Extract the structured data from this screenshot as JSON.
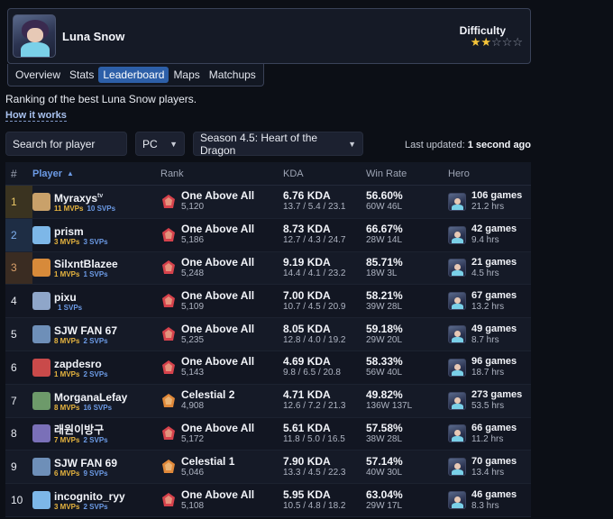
{
  "hero": {
    "name": "Luna Snow",
    "difficulty_label": "Difficulty",
    "difficulty_stars": 2,
    "max_stars": 5
  },
  "tabs": [
    {
      "label": "Overview",
      "active": false
    },
    {
      "label": "Stats",
      "active": false
    },
    {
      "label": "Leaderboard",
      "active": true
    },
    {
      "label": "Maps",
      "active": false
    },
    {
      "label": "Matchups",
      "active": false
    }
  ],
  "description": "Ranking of the best Luna Snow players.",
  "how_link": "How it works",
  "filters": {
    "search_placeholder": "Search for player",
    "platform": "PC",
    "season": "Season 4.5: Heart of the Dragon"
  },
  "updated": {
    "label": "Last updated:",
    "value": "1 second ago"
  },
  "columns": {
    "rank_no": "#",
    "player": "Player",
    "rank": "Rank",
    "kda": "KDA",
    "win_rate": "Win Rate",
    "hero": "Hero"
  },
  "rows": [
    {
      "pos": "1",
      "name": "Myraxys",
      "tag": "tv",
      "mvps": "11 MVPs",
      "svps": "10 SVPs",
      "rank": "One Above All",
      "score": "5,120",
      "kda": "6.76 KDA",
      "kda_detail": "13.7 / 5.4 / 23.1",
      "win": "56.60%",
      "record": "60W 46L",
      "games": "106 games",
      "hours": "21.2 hrs",
      "avatar_color": "#c9a16a",
      "rank_color": "#d6424c"
    },
    {
      "pos": "2",
      "name": "prism",
      "tag": "",
      "mvps": "3 MVPs",
      "svps": "3 SVPs",
      "rank": "One Above All",
      "score": "5,186",
      "kda": "8.73 KDA",
      "kda_detail": "12.7 / 4.3 / 24.7",
      "win": "66.67%",
      "record": "28W 14L",
      "games": "42 games",
      "hours": "9.4 hrs",
      "avatar_color": "#7db7e8",
      "rank_color": "#d6424c"
    },
    {
      "pos": "3",
      "name": "SilxntBlazee",
      "tag": "",
      "mvps": "1 MVPs",
      "svps": "1 SVPs",
      "rank": "One Above All",
      "score": "5,248",
      "kda": "9.19 KDA",
      "kda_detail": "14.4 / 4.1 / 23.2",
      "win": "85.71%",
      "record": "18W 3L",
      "games": "21 games",
      "hours": "4.5 hrs",
      "avatar_color": "#d78a3a",
      "rank_color": "#d6424c"
    },
    {
      "pos": "4",
      "name": "pixu",
      "tag": "",
      "mvps": "",
      "svps": "1 SVPs",
      "rank": "One Above All",
      "score": "5,109",
      "kda": "7.00 KDA",
      "kda_detail": "10.7 / 4.5 / 20.9",
      "win": "58.21%",
      "record": "39W 28L",
      "games": "67 games",
      "hours": "13.2 hrs",
      "avatar_color": "#8fa6c9",
      "rank_color": "#d6424c"
    },
    {
      "pos": "5",
      "name": "SJW FAN 67",
      "tag": "",
      "mvps": "8 MVPs",
      "svps": "2 SVPs",
      "rank": "One Above All",
      "score": "5,235",
      "kda": "8.05 KDA",
      "kda_detail": "12.8 / 4.0 / 19.2",
      "win": "59.18%",
      "record": "29W 20L",
      "games": "49 games",
      "hours": "8.7 hrs",
      "avatar_color": "#6e8fb8",
      "rank_color": "#d6424c"
    },
    {
      "pos": "6",
      "name": "zapdesro",
      "tag": "",
      "mvps": "1 MVPs",
      "svps": "2 SVPs",
      "rank": "One Above All",
      "score": "5,143",
      "kda": "4.69 KDA",
      "kda_detail": "9.8 / 6.5 / 20.8",
      "win": "58.33%",
      "record": "56W 40L",
      "games": "96 games",
      "hours": "18.7 hrs",
      "avatar_color": "#c94a4a",
      "rank_color": "#d6424c"
    },
    {
      "pos": "7",
      "name": "MorganaLefay",
      "tag": "",
      "mvps": "8 MVPs",
      "svps": "16 SVPs",
      "rank": "Celestial 2",
      "score": "4,908",
      "kda": "4.71 KDA",
      "kda_detail": "12.6 / 7.2 / 21.3",
      "win": "49.82%",
      "record": "136W 137L",
      "games": "273 games",
      "hours": "53.5 hrs",
      "avatar_color": "#6d9a6a",
      "rank_color": "#e0893a"
    },
    {
      "pos": "8",
      "name": "래원이방구",
      "tag": "",
      "mvps": "7 MVPs",
      "svps": "2 SVPs",
      "rank": "One Above All",
      "score": "5,172",
      "kda": "5.61 KDA",
      "kda_detail": "11.8 / 5.0 / 16.5",
      "win": "57.58%",
      "record": "38W 28L",
      "games": "66 games",
      "hours": "11.2 hrs",
      "avatar_color": "#7a70b8",
      "rank_color": "#d6424c"
    },
    {
      "pos": "9",
      "name": "SJW FAN 69",
      "tag": "",
      "mvps": "6 MVPs",
      "svps": "9 SVPs",
      "rank": "Celestial 1",
      "score": "5,046",
      "kda": "7.90 KDA",
      "kda_detail": "13.3 / 4.5 / 22.3",
      "win": "57.14%",
      "record": "40W 30L",
      "games": "70 games",
      "hours": "13.4 hrs",
      "avatar_color": "#6e8fb8",
      "rank_color": "#e0893a"
    },
    {
      "pos": "10",
      "name": "incognito_ryy",
      "tag": "",
      "mvps": "3 MVPs",
      "svps": "2 SVPs",
      "rank": "One Above All",
      "score": "5,108",
      "kda": "5.95 KDA",
      "kda_detail": "10.5 / 4.8 / 18.2",
      "win": "63.04%",
      "record": "29W 17L",
      "games": "46 games",
      "hours": "8.3 hrs",
      "avatar_color": "#7db7e8",
      "rank_color": "#d6424c"
    }
  ]
}
